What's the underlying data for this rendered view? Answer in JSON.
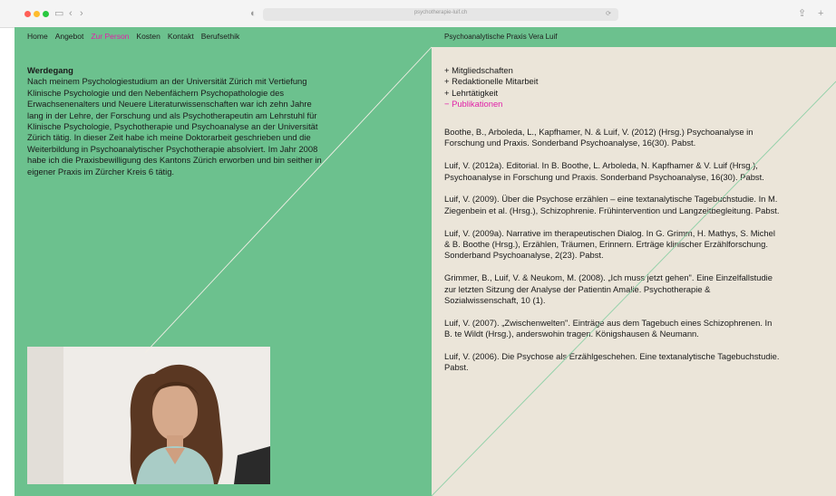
{
  "browser": {
    "url": "psychotherapie-luif.ch"
  },
  "nav": {
    "items": [
      {
        "label": "Home",
        "active": false
      },
      {
        "label": "Angebot",
        "active": false
      },
      {
        "label": "Zur Person",
        "active": true
      },
      {
        "label": "Kosten",
        "active": false
      },
      {
        "label": "Kontakt",
        "active": false
      },
      {
        "label": "Berufsethik",
        "active": false
      }
    ]
  },
  "header": {
    "practice_name": "Psychoanalytische Praxis Vera Luif"
  },
  "werdegang": {
    "title": "Werdegang",
    "text": "Nach meinem Psychologiestudium an der Universität Zürich mit Vertiefung Klinische Psychologie und den Nebenfächern Psychopathologie des Erwachsenenalters und Neuere Literaturwissenschaften war ich zehn Jahre lang in der Lehre, der Forschung und als Psychotherapeutin am Lehrstuhl für Klinische Psychologie, Psychotherapie und Psychoanalyse an der Universität Zürich tätig. In dieser Zeit habe ich meine Doktorarbeit geschrieben und die Weiterbildung in Psychoanalytischer Psychotherapie absolviert. Im Jahr 2008 habe ich die Praxisbewilligung des Kantons Zürich erworben und bin seither in eigener Praxis im Zürcher Kreis 6 tätig."
  },
  "menu": {
    "items": [
      {
        "label": "+ Mitgliedschaften",
        "active": false
      },
      {
        "label": "+ Redaktionelle Mitarbeit",
        "active": false
      },
      {
        "label": "+ Lehrtätigkeit",
        "active": false
      },
      {
        "label": "− Publikationen",
        "active": true
      }
    ]
  },
  "publications": [
    "Boothe, B., Arboleda, L., Kapfhamer, N. & Luif, V. (2012) (Hrsg.) Psychoanalyse in Forschung und Praxis. Sonderband Psychoanalyse, 16(30). Pabst.",
    "Luif, V. (2012a). Editorial. In B. Boothe, L. Arboleda, N. Kapfhamer & V. Luif (Hrsg.), Psychoanalyse in Forschung und Praxis. Sonderband Psychoanalyse, 16(30). Pabst.",
    "Luif, V. (2009). Über die Psychose erzählen – eine textanalytische Tagebuchstudie. In M. Ziegenbein et al. (Hrsg.), Schizophrenie. Frühintervention und Langzeitbegleitung. Pabst.",
    "Luif, V. (2009a). Narrative im therapeutischen Dialog. In G. Grimm, H. Mathys, S. Michel & B. Boothe (Hrsg.), Erzählen, Träumen, Erinnern. Erträge klinischer Erzählforschung. Sonderband Psychoanalyse, 2(23). Pabst.",
    "Grimmer, B., Luif, V. & Neukom, M. (2008). „Ich muss jetzt gehen\". Eine Einzelfallstudie zur letzten Sitzung der Analyse der Patientin Amalie. Psychotherapie & Sozialwissenschaft, 10 (1).",
    "Luif, V. (2007). „Zwischenwelten\". Einträge aus dem Tagebuch eines Schizophrenen. In B. te Wildt (Hrsg.), anderswohin tragen. Königshausen & Neumann.",
    "Luif, V. (2006). Die Psychose als Erzählgeschehen. Eine textanalytische Tagebuchstudie. Pabst."
  ],
  "colors": {
    "green": "#6cc18e",
    "beige": "#ebe5d9",
    "accent": "#e020a8"
  }
}
